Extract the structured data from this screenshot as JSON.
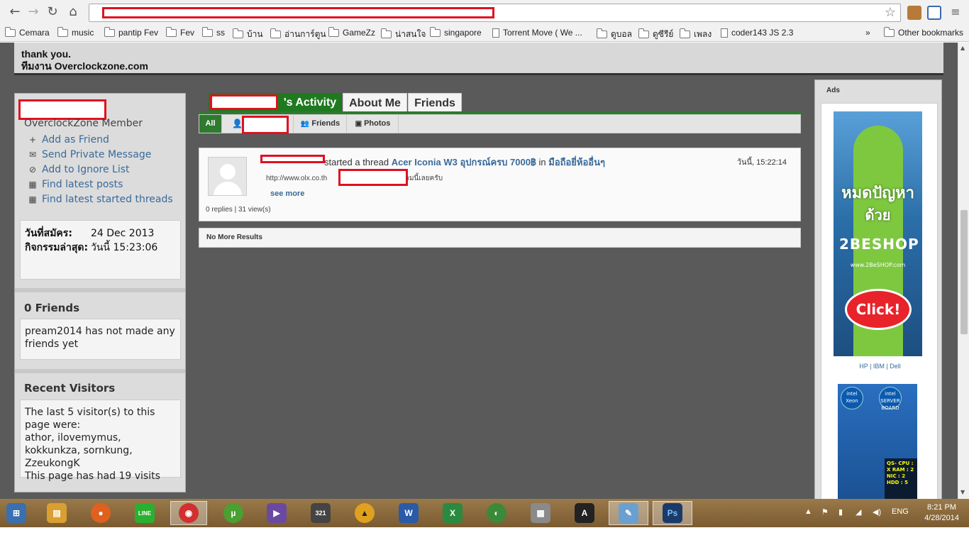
{
  "browser": {
    "nav": {
      "back": "←",
      "forward": "→",
      "reload": "↻",
      "home": "⌂"
    },
    "star": "☆",
    "bookmarks": [
      {
        "label": "Cemara",
        "icon": "folder-icon"
      },
      {
        "label": "music",
        "icon": "folder-icon"
      },
      {
        "label": "pantip Fev",
        "icon": "folder-icon"
      },
      {
        "label": "Fev",
        "icon": "folder-icon"
      },
      {
        "label": "ss",
        "icon": "folder-icon"
      },
      {
        "label": "บ้าน",
        "icon": "folder-icon"
      },
      {
        "label": "อ่านการ์ตูน",
        "icon": "folder-icon"
      },
      {
        "label": "GameZz",
        "icon": "folder-icon"
      },
      {
        "label": "น่าสนใจ",
        "icon": "folder-icon"
      },
      {
        "label": "singapore",
        "icon": "folder-icon"
      },
      {
        "label": "Torrent Move ( We ...",
        "icon": "page-icon"
      },
      {
        "label": "ดูบอล",
        "icon": "folder-icon"
      },
      {
        "label": "ดูซีรีย์",
        "icon": "folder-icon"
      },
      {
        "label": "เพลง",
        "icon": "folder-icon"
      },
      {
        "label": "coder143 JS 2.3",
        "icon": "page-icon"
      }
    ],
    "more": "»",
    "other_bookmarks": "Other bookmarks"
  },
  "notice": {
    "line1": "thank you.",
    "line2": "ทีมงาน Overclockzone.com"
  },
  "profile": {
    "member_title": "OverclockZone Member",
    "actions": [
      {
        "icon": "+",
        "label": "Add as Friend"
      },
      {
        "icon": "✉",
        "label": "Send Private Message"
      },
      {
        "icon": "⊘",
        "label": "Add to Ignore List"
      },
      {
        "icon": "▦",
        "label": "Find latest posts"
      },
      {
        "icon": "▦",
        "label": "Find latest started threads"
      }
    ],
    "stats": {
      "joined_label": "วันที่สมัคร:",
      "joined_value": "24 Dec 2013",
      "activity_label": "กิจกรรมล่าสุด:",
      "activity_value": "วันนี้ 15:23:06"
    },
    "friends": {
      "heading": "0 Friends",
      "text": "pream2014 has not made any friends yet"
    },
    "visitors": {
      "heading": "Recent Visitors",
      "intro": "The last 5 visitor(s) to this page were:",
      "list": "athor, ilovemymus, kokkunkza, sornkung, ZzeukongK",
      "visits": "This page has had 19 visits"
    }
  },
  "tabs": {
    "activity": "'s Activity",
    "about": "About Me",
    "friends": "Friends"
  },
  "filters": {
    "all": "All",
    "friends": "Friends",
    "photos": "Photos"
  },
  "post": {
    "action": "started a thread",
    "thread_title": "Acer Iconia W3 อุปกรณ์ครบ 7000฿",
    "in": "in",
    "forum": "มือถือยี่ห้ออื่นๆ",
    "time": "วันนี้, 15:22:14",
    "snippet_start": "http://www.olx.co.th",
    "snippet_end": "ถามนี้เลยครับ",
    "see_more": "see more",
    "stats": "0 replies | 31 view(s)"
  },
  "no_more": "No More Results",
  "ads": {
    "title": "Ads",
    "ad1_line1": "หมดปัญหา",
    "ad1_line2": "ด้วย",
    "ad1_logo": "2BESHOP",
    "ad1_site": "www.2BeSHOP.com",
    "ad1_click": "Click!",
    "links": "HP | IBM | Dell",
    "ad2_badge1": "intel Xeon",
    "ad2_badge2": "intel SERVER BOARD",
    "ad2_spec": "QS- CPU : X RAM : 2 NIC : 2 HDD : 5"
  },
  "taskbar": {
    "apps": [
      {
        "name": "windows-start-icon",
        "glyph": "⊞",
        "color": "#3a6fb0"
      },
      {
        "name": "file-explorer-icon",
        "glyph": "▤",
        "color": "#d8a030"
      },
      {
        "name": "firefox-icon",
        "glyph": "●",
        "color": "#e06020"
      },
      {
        "name": "line-icon",
        "glyph": "LINE",
        "color": "#2ab030"
      },
      {
        "name": "chrome-icon",
        "glyph": "◉",
        "color": "#d03030"
      },
      {
        "name": "utorrent-icon",
        "glyph": "µ",
        "color": "#4aa030"
      },
      {
        "name": "visual-studio-icon",
        "glyph": "▶",
        "color": "#6a4aa0"
      },
      {
        "name": "media-player-classic-icon",
        "glyph": "321",
        "color": "#444444"
      },
      {
        "name": "aimp-icon",
        "glyph": "▲",
        "color": "#e0a020"
      },
      {
        "name": "word-icon",
        "glyph": "W",
        "color": "#2a5aa8"
      },
      {
        "name": "excel-icon",
        "glyph": "X",
        "color": "#2a8a40"
      },
      {
        "name": "internet-download-manager-icon",
        "glyph": "◐",
        "color": "#3a8a3a"
      },
      {
        "name": "calculator-icon",
        "glyph": "▦",
        "color": "#8a8a8a"
      },
      {
        "name": "autocad-icon",
        "glyph": "A",
        "color": "#222222"
      },
      {
        "name": "paint-icon",
        "glyph": "✎",
        "color": "#6aa0d0"
      },
      {
        "name": "photoshop-icon",
        "glyph": "Ps",
        "color": "#1a3a6a"
      }
    ],
    "lang": "ENG",
    "time": "8:21 PM",
    "date": "4/28/2014"
  }
}
